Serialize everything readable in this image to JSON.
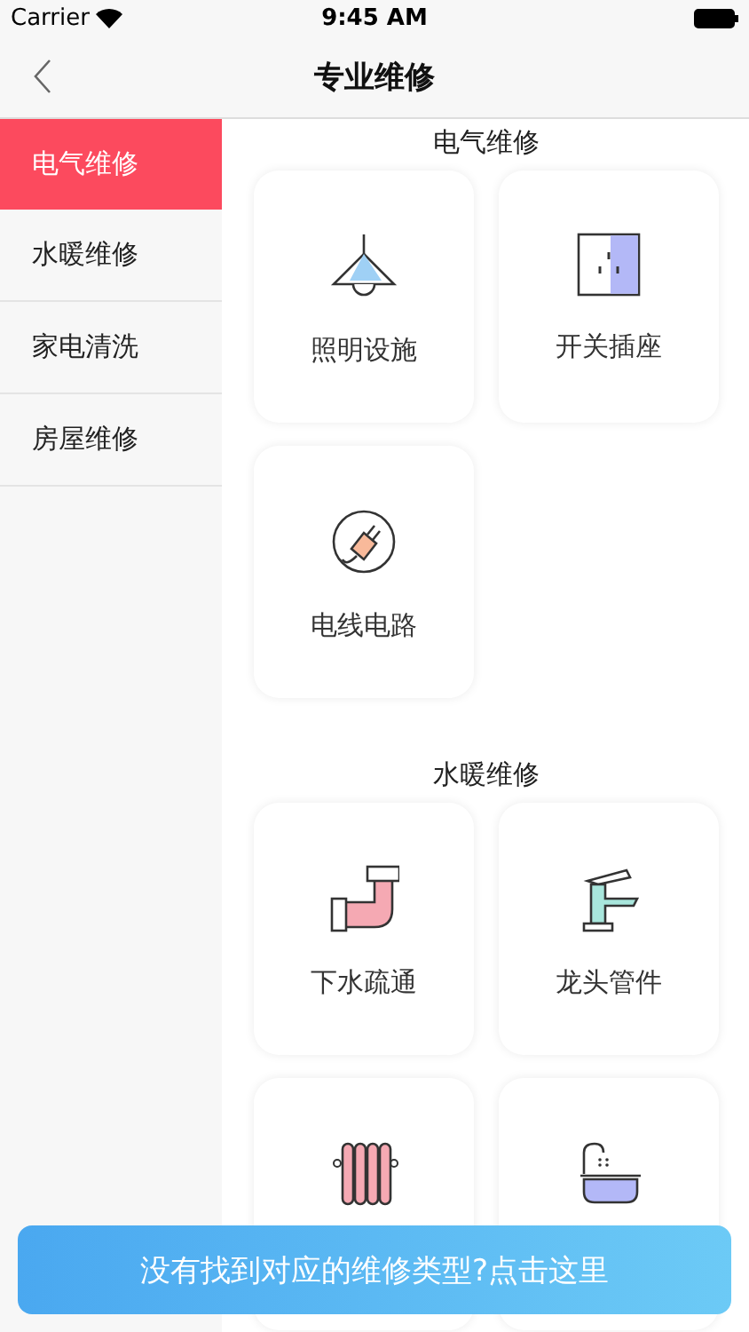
{
  "status_bar": {
    "carrier": "Carrier",
    "time": "9:45 AM"
  },
  "nav": {
    "title": "专业维修"
  },
  "sidebar": {
    "items": [
      {
        "label": "电气维修",
        "selected": true
      },
      {
        "label": "水暖维修",
        "selected": false
      },
      {
        "label": "家电清洗",
        "selected": false
      },
      {
        "label": "房屋维修",
        "selected": false
      }
    ]
  },
  "sections": [
    {
      "title": "电气维修",
      "cards": [
        {
          "kind": "lamp",
          "label": "照明设施"
        },
        {
          "kind": "socket",
          "label": "开关插座"
        },
        {
          "kind": "plug",
          "label": "电线电路"
        }
      ]
    },
    {
      "title": "水暖维修",
      "cards": [
        {
          "kind": "pipe",
          "label": "下水疏通"
        },
        {
          "kind": "faucet",
          "label": "龙头管件"
        },
        {
          "kind": "radiator"
        },
        {
          "kind": "bathtub"
        }
      ]
    }
  ],
  "floating_button": {
    "label": "没有找到对应的维修类型?点击这里"
  }
}
